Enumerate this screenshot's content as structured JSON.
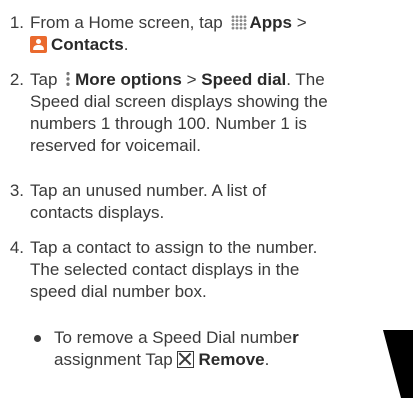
{
  "steps": [
    {
      "number": "1.",
      "text_a": "From a Home screen, tap ",
      "apps_label": "Apps",
      "text_b": " >",
      "contacts_label": "Contacts",
      "text_c": "."
    },
    {
      "number": "2.",
      "text_a": "Tap ",
      "more_options_label": "More options",
      "text_b": " > ",
      "speed_dial_label": "Speed dial",
      "text_c": ". The",
      "lines": [
        "Speed dial screen displays showing the",
        "numbers 1 through 100. Number 1 is",
        "reserved for voicemail."
      ]
    },
    {
      "number": "3.",
      "lines": [
        "Tap an unused number. A list of",
        "contacts displays."
      ]
    },
    {
      "number": "4.",
      "lines": [
        "Tap a contact to assign to the number.",
        "The selected contact displays in the",
        "speed dial number box."
      ]
    }
  ],
  "bullet": {
    "line1_a": "To remove a Speed Dial numbe",
    "line1_b": "r",
    "line2_a": "assignment Tap ",
    "remove_label": "Remove",
    "line2_b": "."
  },
  "icons": {
    "apps": "apps-grid-icon",
    "contacts": "contacts-icon",
    "more_options": "more-options-icon",
    "remove": "close-icon"
  },
  "colors": {
    "text": "#3a3a3a",
    "contacts_icon": "#ea6a2e",
    "corner_shape": "#000000"
  }
}
